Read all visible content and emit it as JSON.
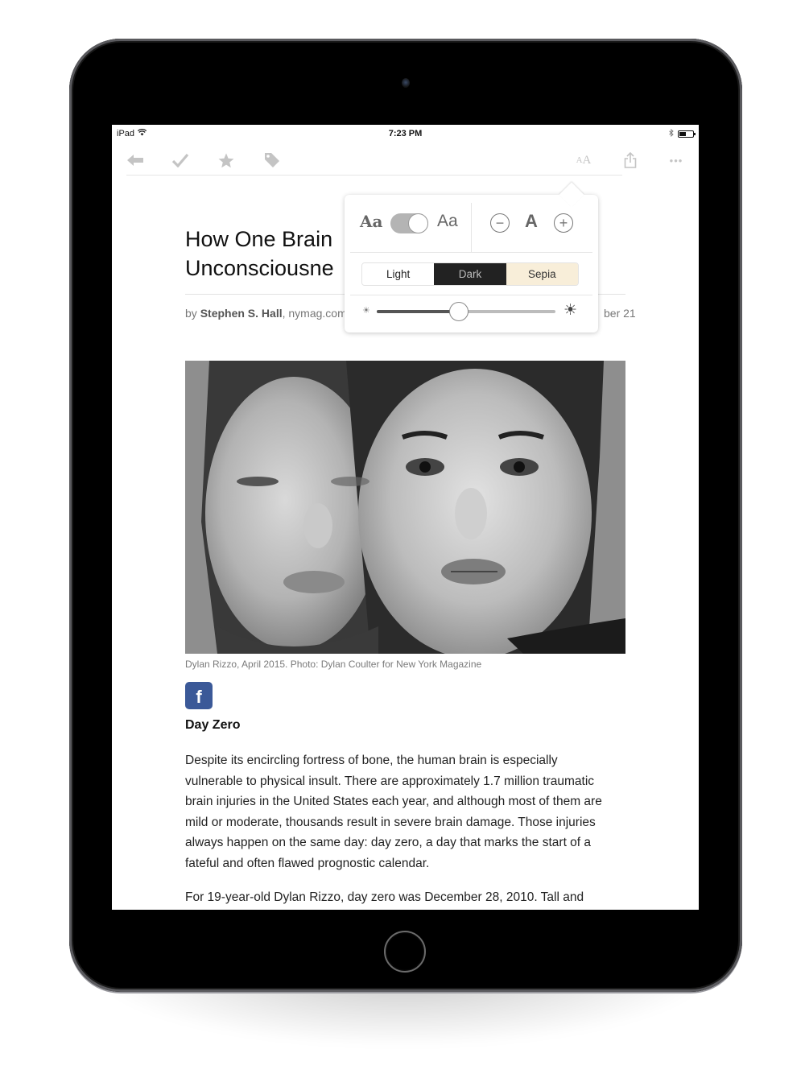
{
  "status_bar": {
    "device": "iPad",
    "time": "7:23 PM",
    "battery_level": 0.5
  },
  "toolbar": {
    "left_icons": [
      "back-arrow-icon",
      "checkmark-icon",
      "star-icon",
      "tag-icon"
    ],
    "right_icons": [
      "text-size-icon",
      "share-icon",
      "more-icon"
    ],
    "text_size_label": "AA",
    "more_label": "•••"
  },
  "article": {
    "title_lines": [
      "How One Brain",
      "Unconsciousne"
    ],
    "byline_prefix": "by ",
    "author": "Stephen S. Hall",
    "source": ", nymag.com",
    "date_fragment": "ber 21",
    "photo_caption": "Dylan Rizzo, April 2015. Photo: Dylan Coulter for New York Magazine",
    "share_icon_label": "f",
    "section_heading": "Day Zero",
    "paragraphs": [
      [
        "Despite its encircling fortress of bone, the human brain is especially",
        "vulnerable to physical insult. There are approximately 1.7 million traumatic",
        "brain injuries in the United States each year, and although most of them are",
        "mild or moderate, thousands result in severe brain damage. Those injuries",
        "always happen on the same day: day zero, a day that marks the start of a",
        "fateful and often flawed prognostic calendar."
      ],
      [
        "For 19-year-old Dylan Rizzo, day zero was December 28, 2010. Tall and"
      ]
    ]
  },
  "display_popover": {
    "serif_font_label": "Aa",
    "sans_font_label": "Aa",
    "font_toggle_on": true,
    "decrease_label": "−",
    "size_label": "A",
    "increase_label": "+",
    "themes": [
      "Light",
      "Dark",
      "Sepia"
    ],
    "brightness": 0.46,
    "brightness_low_icon": "☀",
    "brightness_high_icon": "☀"
  },
  "colors": {
    "facebook_blue": "#3b5998",
    "dark_theme": "#222222",
    "sepia_theme": "#f8eed9",
    "toolbar_icon_gray": "#c4c4c4"
  }
}
